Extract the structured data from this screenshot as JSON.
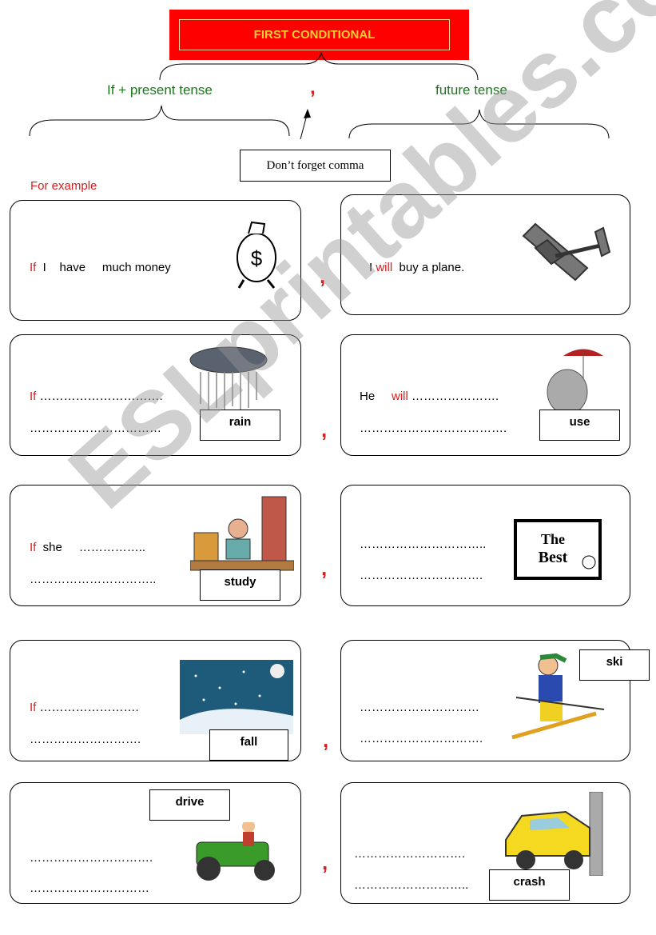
{
  "title": "FIRST CONDITIONAL",
  "structure": {
    "left": "If  + present tense",
    "comma": ",",
    "right": "future tense",
    "note": "Don’t forget comma"
  },
  "example_label": "For example",
  "rows": [
    {
      "left": {
        "if": "If",
        "rest": "  I    have     much money"
      },
      "right": {
        "pre": "I ",
        "will": "will",
        "rest": "  buy a plane."
      },
      "comma": ","
    },
    {
      "left": {
        "if": "If",
        "rest": " ………………………….",
        "line2": "……………………………"
      },
      "left_word": "rain",
      "right": {
        "pre": "He     ",
        "will": "will",
        "rest": " ………………….",
        "line2": "………………………………."
      },
      "right_word": "use",
      "comma": ","
    },
    {
      "left": {
        "if": "If",
        "rest": "  she     ……………..",
        "line2": "………………………….."
      },
      "left_word": "study",
      "right": {
        "line1": "…………………………..",
        "line2": "…………………………."
      },
      "comma": ","
    },
    {
      "left": {
        "if": "If",
        "rest": " …………………….",
        "line2": "………………………."
      },
      "left_word": "fall",
      "right": {
        "line1": "…………………………",
        "line2": "…………………………."
      },
      "right_word": "ski",
      "comma": ","
    },
    {
      "left": {
        "line1": "………………………….",
        "line2": "…………………………"
      },
      "left_word": "drive",
      "right": {
        "line1": "……………………….",
        "line2": "……………………….."
      },
      "right_word": "crash",
      "comma": ","
    }
  ],
  "watermark": "ESLprintables.com",
  "colors": {
    "title_bg": "#ff0000",
    "title_text": "#ffcc33",
    "green": "#1a7a1a",
    "red": "#d62020"
  }
}
